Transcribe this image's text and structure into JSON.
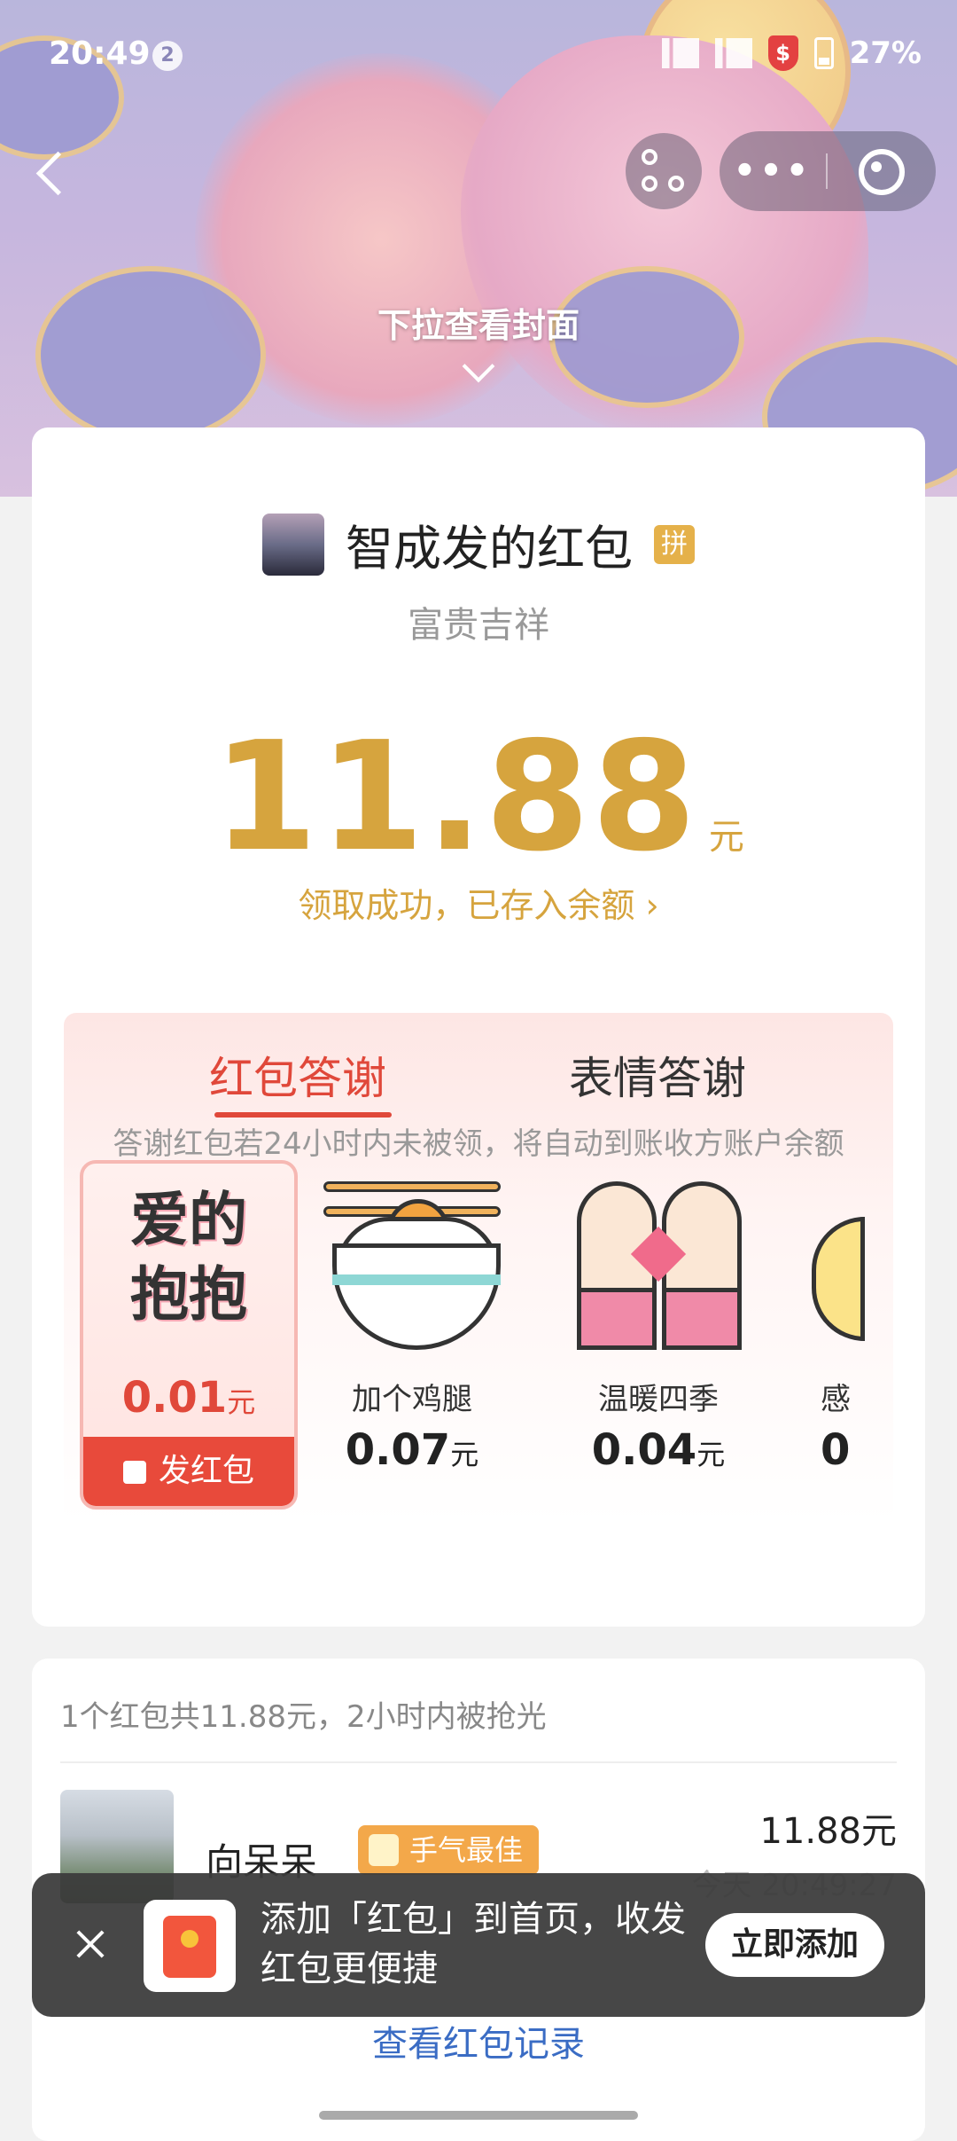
{
  "status_bar": {
    "time": "20:49",
    "notification_count": "2",
    "battery": "27%"
  },
  "header": {
    "pull_hint": "下拉查看封面"
  },
  "packet": {
    "sender_name": "智成发的红包",
    "badge": "拼",
    "blessing": "富贵吉祥",
    "amount": "11.88",
    "unit": "元",
    "received_text": "领取成功，已存入余额",
    "received_arrow": "›"
  },
  "thanks": {
    "tabs": [
      {
        "label": "红包答谢",
        "active": true
      },
      {
        "label": "表情答谢",
        "active": false
      }
    ],
    "items": [
      {
        "label": "爱的抱抱",
        "price": "0.01",
        "unit": "元",
        "selected": true,
        "action": "发红包"
      },
      {
        "label": "加个鸡腿",
        "price": "0.07",
        "unit": "元"
      },
      {
        "label": "温暖四季",
        "price": "0.04",
        "unit": "元"
      },
      {
        "label": "感",
        "price": "0",
        "unit": ""
      }
    ],
    "note": "答谢红包若24小时内未被领，将自动到账收方账户余额"
  },
  "records": {
    "summary": "1个红包共11.88元，2小时内被抢光",
    "rows": [
      {
        "name": "向呆呆",
        "tag": "手气最佳",
        "amount": "11.88元",
        "time": "今天 20:49:27"
      }
    ],
    "view_all": "查看红包记录"
  },
  "toast": {
    "message": "添加「红包」到首页，收发红包更便捷",
    "action": "立即添加"
  },
  "colors": {
    "accent_gold": "#d6a43e",
    "accent_red": "#e0483a",
    "link_blue": "#3a6cc4"
  }
}
